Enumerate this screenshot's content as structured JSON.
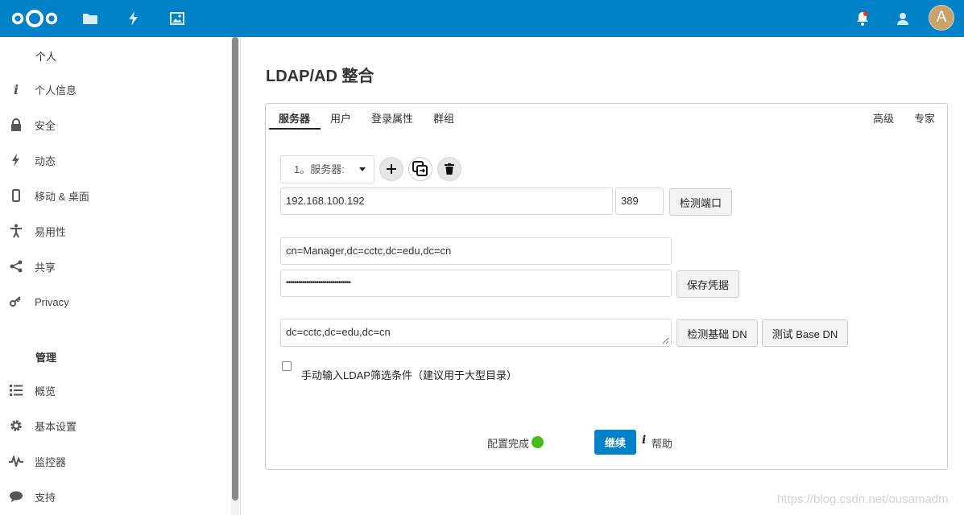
{
  "header": {
    "brand": "Nextcloud",
    "apps": [
      "files-icon",
      "activity-icon",
      "gallery-icon"
    ],
    "avatar_letter": "A",
    "accent": "#0082c9"
  },
  "sidebar": {
    "personal_heading": "个人",
    "personal_items": [
      {
        "label": "个人信息",
        "icon": "info-icon"
      },
      {
        "label": "安全",
        "icon": "lock-icon"
      },
      {
        "label": "动态",
        "icon": "activity-icon"
      },
      {
        "label": "移动 & 桌面",
        "icon": "phone-icon"
      },
      {
        "label": "易用性",
        "icon": "accessibility-icon"
      },
      {
        "label": "共享",
        "icon": "share-icon"
      },
      {
        "label": "Privacy",
        "icon": "key-icon"
      }
    ],
    "admin_heading": "管理",
    "admin_items": [
      {
        "label": "概览",
        "icon": "list-icon"
      },
      {
        "label": "基本设置",
        "icon": "gear-icon"
      },
      {
        "label": "监控器",
        "icon": "pulse-icon"
      },
      {
        "label": "支持",
        "icon": "chat-icon"
      }
    ]
  },
  "page": {
    "title": "LDAP/AD 整合",
    "tabs_left": [
      "服务器",
      "用户",
      "登录属性",
      "群组"
    ],
    "tabs_right": [
      "高级",
      "专家"
    ],
    "server_select": "1。服务器:",
    "host": "192.168.100.192",
    "port": "389",
    "detect_port": "检测端口",
    "user_dn": "cn=Manager,dc=cctc,dc=edu,dc=cn",
    "password_mask": "••••••••••••••••••••••••••••••••",
    "save_credentials": "保存凭据",
    "base_dn": "dc=cctc,dc=edu,dc=cn",
    "detect_base_dn": "检测基础 DN",
    "test_base_dn": "测试 Base DN",
    "manual_filter_label": "手动输入LDAP筛选条件（建议用于大型目录）",
    "config_status": "配置完成",
    "status_color": "#46ba18",
    "continue": "继续",
    "help": "帮助"
  },
  "watermark": "https://blog.csdn.net/ousamadm"
}
